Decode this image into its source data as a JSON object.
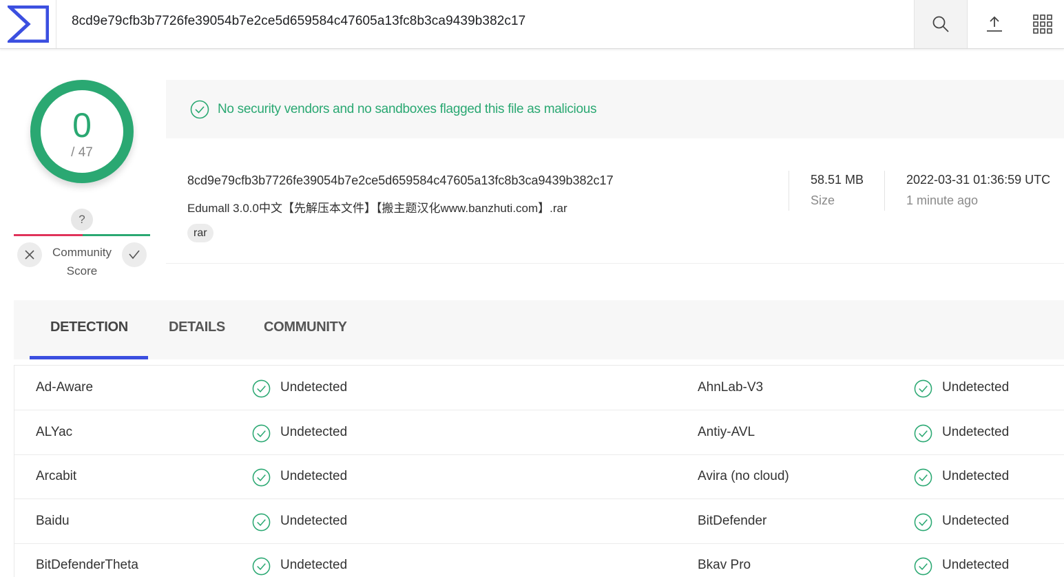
{
  "header": {
    "search_value": "8cd9e79cfb3b7726fe39054b7e2ce5d659584c47605a13fc8b3ca9439b382c17",
    "icons": [
      "virustotal-logo",
      "search-icon",
      "upload-icon",
      "apps-grid-icon"
    ]
  },
  "score": {
    "detections": "0",
    "total": "/ 47",
    "community_question": "?",
    "community_label_line1": "Community",
    "community_label_line2": "Score"
  },
  "summary": {
    "message": "No security vendors and no sandboxes flagged this file as malicious",
    "hash": "8cd9e79cfb3b7726fe39054b7e2ce5d659584c47605a13fc8b3ca9439b382c17",
    "filename": "Edumall 3.0.0中文【先解压本文件】【搬主题汉化www.banzhuti.com】.rar",
    "tag": "rar",
    "size_value": "58.51 MB",
    "size_label": "Size",
    "date_value": "2022-03-31 01:36:59 UTC",
    "date_label": "1 minute ago"
  },
  "tabs": [
    {
      "label": "DETECTION",
      "active": true
    },
    {
      "label": "DETAILS",
      "active": false
    },
    {
      "label": "COMMUNITY",
      "active": false
    }
  ],
  "results": [
    {
      "left_vendor": "Ad-Aware",
      "left_status": "Undetected",
      "right_vendor": "AhnLab-V3",
      "right_status": "Undetected"
    },
    {
      "left_vendor": "ALYac",
      "left_status": "Undetected",
      "right_vendor": "Antiy-AVL",
      "right_status": "Undetected"
    },
    {
      "left_vendor": "Arcabit",
      "left_status": "Undetected",
      "right_vendor": "Avira (no cloud)",
      "right_status": "Undetected"
    },
    {
      "left_vendor": "Baidu",
      "left_status": "Undetected",
      "right_vendor": "BitDefender",
      "right_status": "Undetected"
    },
    {
      "left_vendor": "BitDefenderTheta",
      "left_status": "Undetected",
      "right_vendor": "Bkav Pro",
      "right_status": "Undetected"
    }
  ],
  "colors": {
    "clean_green": "#2aa872",
    "accent_blue": "#3b4fe0",
    "negative_red": "#e0335a"
  }
}
